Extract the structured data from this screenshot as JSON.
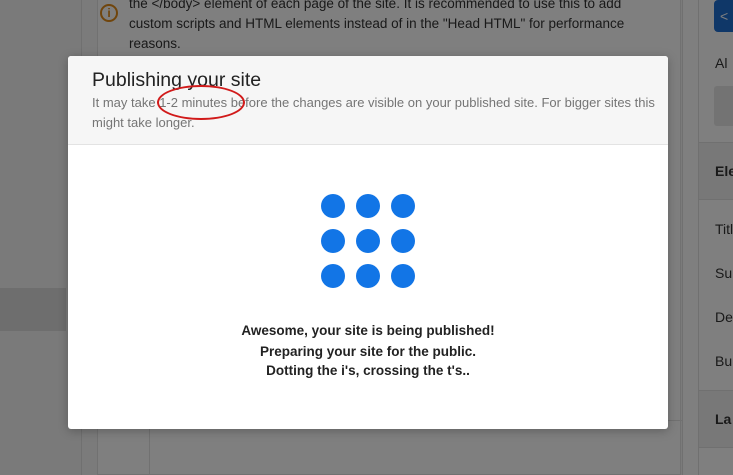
{
  "background": {
    "info_icon_glyph": "i",
    "info_text_lines": [
      "the </body> element of each page of the site. It is recommended to use this to add",
      "custom scripts and HTML elements instead of in the \"Head HTML\" for performance",
      "reasons."
    ],
    "right_panel": {
      "button_glyph": "<",
      "heading_1": "Al",
      "section_1": "Ele",
      "items": [
        "Titl",
        "Sul",
        "De",
        "Bu"
      ],
      "section_2": "La"
    }
  },
  "modal": {
    "title": "Publishing your site",
    "subtitle": "It may take 1-2 minutes before the changes are visible on your published site. For bigger sites this might take longer.",
    "spinner_dots": 9,
    "messages": [
      "Awesome, your site is being published!",
      "Preparing your site for the public.",
      "Dotting the i's, crossing the t's.."
    ]
  },
  "colors": {
    "accent": "#1275e6",
    "annotation": "#d11a1a",
    "info_icon": "#e08a18",
    "overlay": "rgba(0,0,0,0.5)"
  }
}
